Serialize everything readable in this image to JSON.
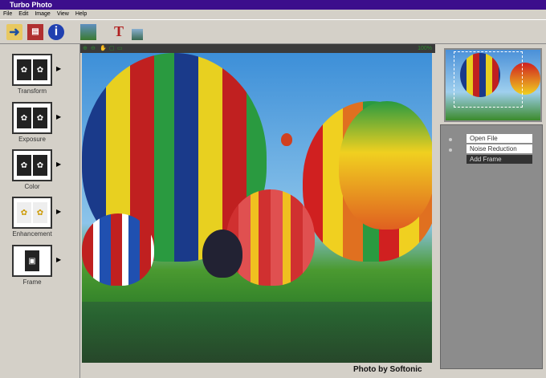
{
  "window": {
    "title": "Turbo Photo"
  },
  "menu": [
    "File",
    "Edit",
    "Image",
    "View",
    "Help"
  ],
  "toolbar": [
    {
      "icon": "open-icon"
    },
    {
      "icon": "save-icon"
    },
    {
      "icon": "info-icon"
    },
    {
      "icon": "image-icon"
    },
    {
      "icon": "text-icon"
    },
    {
      "icon": "add-image-icon"
    }
  ],
  "tools": [
    {
      "label": "Transform"
    },
    {
      "label": "Exposure"
    },
    {
      "label": "Color"
    },
    {
      "label": "Enhancement"
    },
    {
      "label": "Frame"
    }
  ],
  "viewer": {
    "zoom": "100%",
    "caption": "Photo by Softonic"
  },
  "history": [
    {
      "label": "Open File",
      "active": false
    },
    {
      "label": "Noise Reduction",
      "active": false
    },
    {
      "label": "Add Frame",
      "active": true
    }
  ]
}
